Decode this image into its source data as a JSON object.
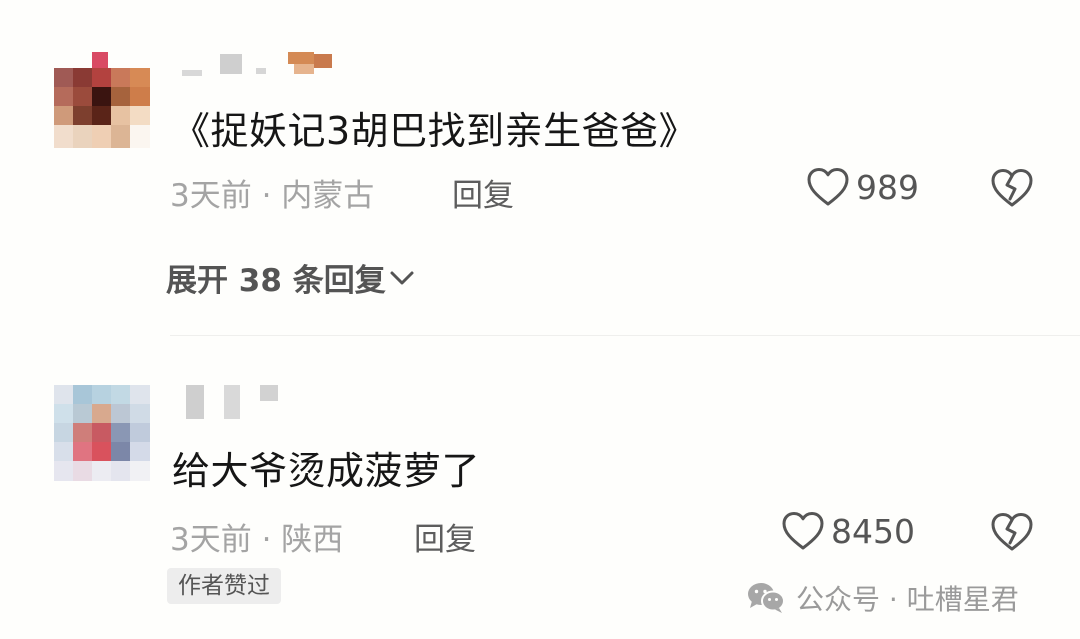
{
  "comments": [
    {
      "text": "《捉妖记3胡巴找到亲生爸爸》",
      "meta": "3天前 · 内蒙古",
      "reply_label": "回复",
      "like_count": "989",
      "expand_label": "展开 38 条回复"
    },
    {
      "text": "给大爷烫成菠萝了",
      "meta": "3天前 · 陕西",
      "reply_label": "回复",
      "like_count": "8450",
      "badge": "作者赞过"
    }
  ],
  "watermark": {
    "text": "公众号 · 吐槽星君",
    "icon": "wechat-icon"
  },
  "icons": {
    "like": "heart-outline-icon",
    "dislike": "broken-heart-icon",
    "expand": "chevron-down-icon"
  },
  "colors": {
    "background": "#fefefc",
    "text_primary": "#161616",
    "text_meta": "#a4a4a4",
    "text_secondary": "#555555",
    "badge_bg": "#ededed"
  }
}
